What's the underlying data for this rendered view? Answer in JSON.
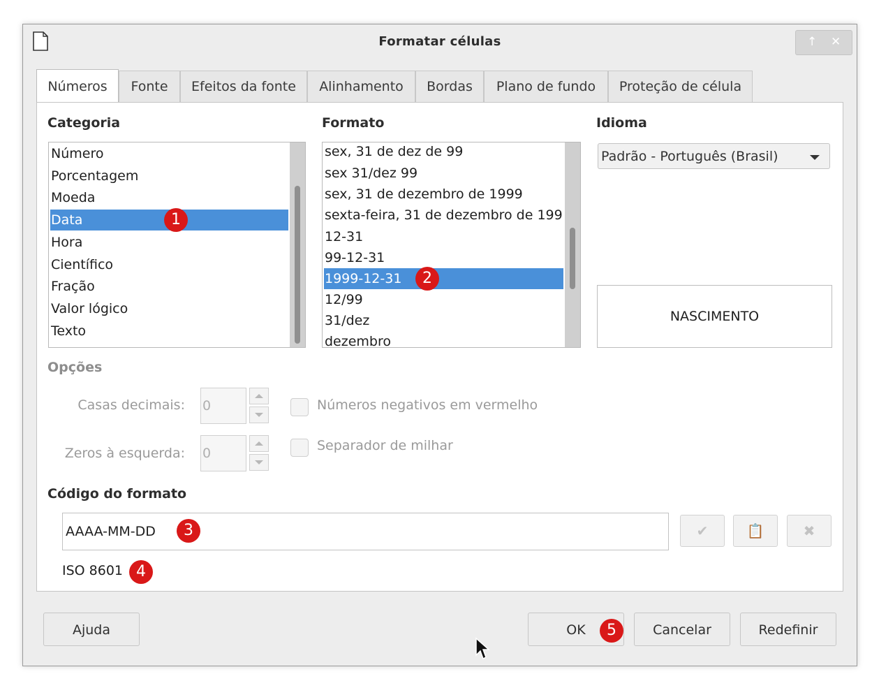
{
  "dialog": {
    "title": "Formatar células",
    "title_buttons": [
      "up-arrow-icon",
      "close-icon"
    ]
  },
  "tabs": [
    "Números",
    "Fonte",
    "Efeitos da fonte",
    "Alinhamento",
    "Bordas",
    "Plano de fundo",
    "Proteção de célula"
  ],
  "active_tab": "Números",
  "category": {
    "label": "Categoria",
    "items": [
      "Número",
      "Porcentagem",
      "Moeda",
      "Data",
      "Hora",
      "Científico",
      "Fração",
      "Valor lógico",
      "Texto"
    ],
    "selected": "Data"
  },
  "format": {
    "label": "Formato",
    "items": [
      "sex, 31 de dez de 99",
      "sex 31/dez 99",
      "sex, 31 de dezembro de 1999",
      "sexta-feira, 31 de dezembro de 199",
      "12-31",
      "99-12-31",
      "1999-12-31",
      "12/99",
      "31/dez",
      "dezembro"
    ],
    "selected": "1999-12-31"
  },
  "language": {
    "label": "Idioma",
    "value": "Padrão - Português (Brasil)"
  },
  "preview": "NASCIMENTO",
  "options": {
    "label": "Opções",
    "decimals_label": "Casas decimais:",
    "decimals_value": "0",
    "leading_zeros_label": "Zeros à esquerda:",
    "leading_zeros_value": "0",
    "negative_red_label": "Números negativos em vermelho",
    "thousands_label": "Separador de milhar"
  },
  "format_code": {
    "label": "Código do formato",
    "value": "AAAA-MM-DD",
    "description": "ISO 8601",
    "icons": [
      "check-icon",
      "add-comment-icon",
      "delete-icon"
    ]
  },
  "badges": [
    "1",
    "2",
    "3",
    "4",
    "5"
  ],
  "buttons": {
    "help": "Ajuda",
    "ok": "OK",
    "cancel": "Cancelar",
    "reset": "Redefinir"
  },
  "colors": {
    "selection": "#4a90d9",
    "badge": "#d91818"
  }
}
